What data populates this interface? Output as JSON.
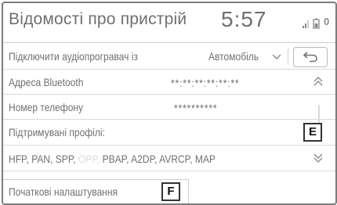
{
  "header": {
    "title": "Відомості про пристрій",
    "clock": "5:57",
    "status_icons": [
      "signal-icon",
      "battery-icon",
      "bluetooth-connected-icon"
    ],
    "status_extra": "0"
  },
  "rows": {
    "connect": {
      "label": "Підключити аудіопрогравач із",
      "value": "Автомобіль",
      "dropdown_icon": "chevron-down-icon",
      "back_icon": "back-arrow-icon"
    },
    "bluetooth_address": {
      "label": "Адреса Bluetooth",
      "value": "**:**:**:**:**:**"
    },
    "phone_number": {
      "label": "Номер телефону",
      "value": "**********"
    },
    "supported_profiles": {
      "label": "Підтримувані профілі:",
      "badge": "E"
    },
    "profiles_list": {
      "before": "HFP, PAN, SPP, ",
      "faded": "OPP, ",
      "after": "PBAP, A2DP, AVRCP, MAP"
    }
  },
  "scroll": {
    "up_icon": "double-chevron-up-icon",
    "down_icon": "double-chevron-down-icon"
  },
  "initial_settings": {
    "label": "Початкові налаштування",
    "badge": "F"
  }
}
